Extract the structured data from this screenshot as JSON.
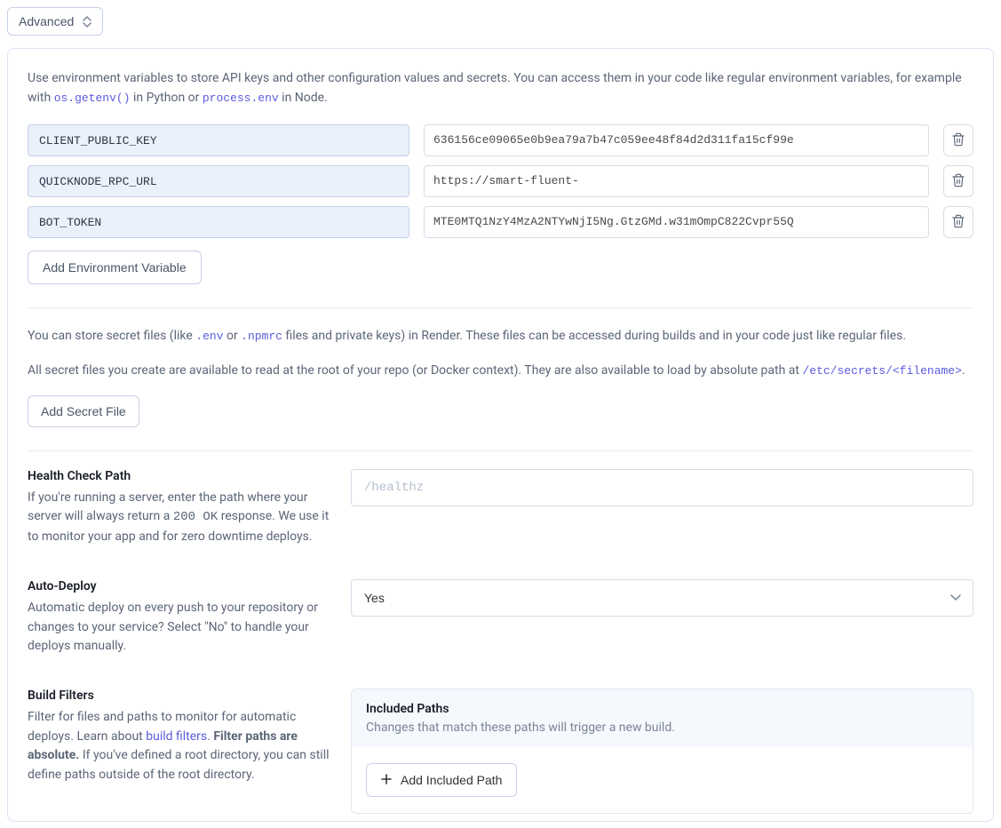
{
  "advanced_label": "Advanced",
  "intro": {
    "pre": "Use environment variables to store API keys and other configuration values and secrets. You can access them in your code like regular environment variables, for example with ",
    "code1": "os.getenv()",
    "mid": " in Python or ",
    "code2": "process.env",
    "post": " in Node."
  },
  "env_vars": [
    {
      "key": "CLIENT_PUBLIC_KEY",
      "value": "636156ce09065e0b9ea79a7b47c059ee48f84d2d311fa15cf99e"
    },
    {
      "key": "QUICKNODE_RPC_URL",
      "value": "https://smart-fluent-"
    },
    {
      "key": "BOT_TOKEN",
      "value": "MTE0MTQ1NzY4MzA2NTYwNjI5Ng.GtzGMd.w31mOmpC822Cvpr55Q"
    }
  ],
  "add_env_label": "Add Environment Variable",
  "secret_para1": {
    "pre": "You can store secret files (like ",
    "code1": ".env",
    "mid1": " or ",
    "code2": ".npmrc",
    "post": " files and private keys) in Render. These files can be accessed during builds and in your code just like regular files."
  },
  "secret_para2": {
    "pre": "All secret files you create are available to read at the root of your repo (or Docker context). They are also available to load by absolute path at ",
    "code1": "/etc/secrets/<filename>",
    "post": "."
  },
  "add_secret_label": "Add Secret File",
  "health": {
    "title": "Health Check Path",
    "desc_pre": "If you're running a server, enter the path where your server will always return a ",
    "desc_code": "200 OK",
    "desc_post": " response. We use it to monitor your app and for zero downtime deploys.",
    "placeholder": "/healthz"
  },
  "autodeploy": {
    "title": "Auto-Deploy",
    "desc": "Automatic deploy on every push to your repository or changes to your service? Select \"No\" to handle your deploys manually.",
    "value": "Yes"
  },
  "filters": {
    "title": "Build Filters",
    "desc_pre": "Filter for files and paths to monitor for automatic deploys. Learn about ",
    "link": "build filters",
    "desc_mid": ". ",
    "bold": "Filter paths are absolute.",
    "desc_post": " If you've defined a root directory, you can still define paths outside of the root directory.",
    "included_title": "Included Paths",
    "included_desc": "Changes that match these paths will trigger a new build.",
    "add_included": "Add Included Path"
  }
}
